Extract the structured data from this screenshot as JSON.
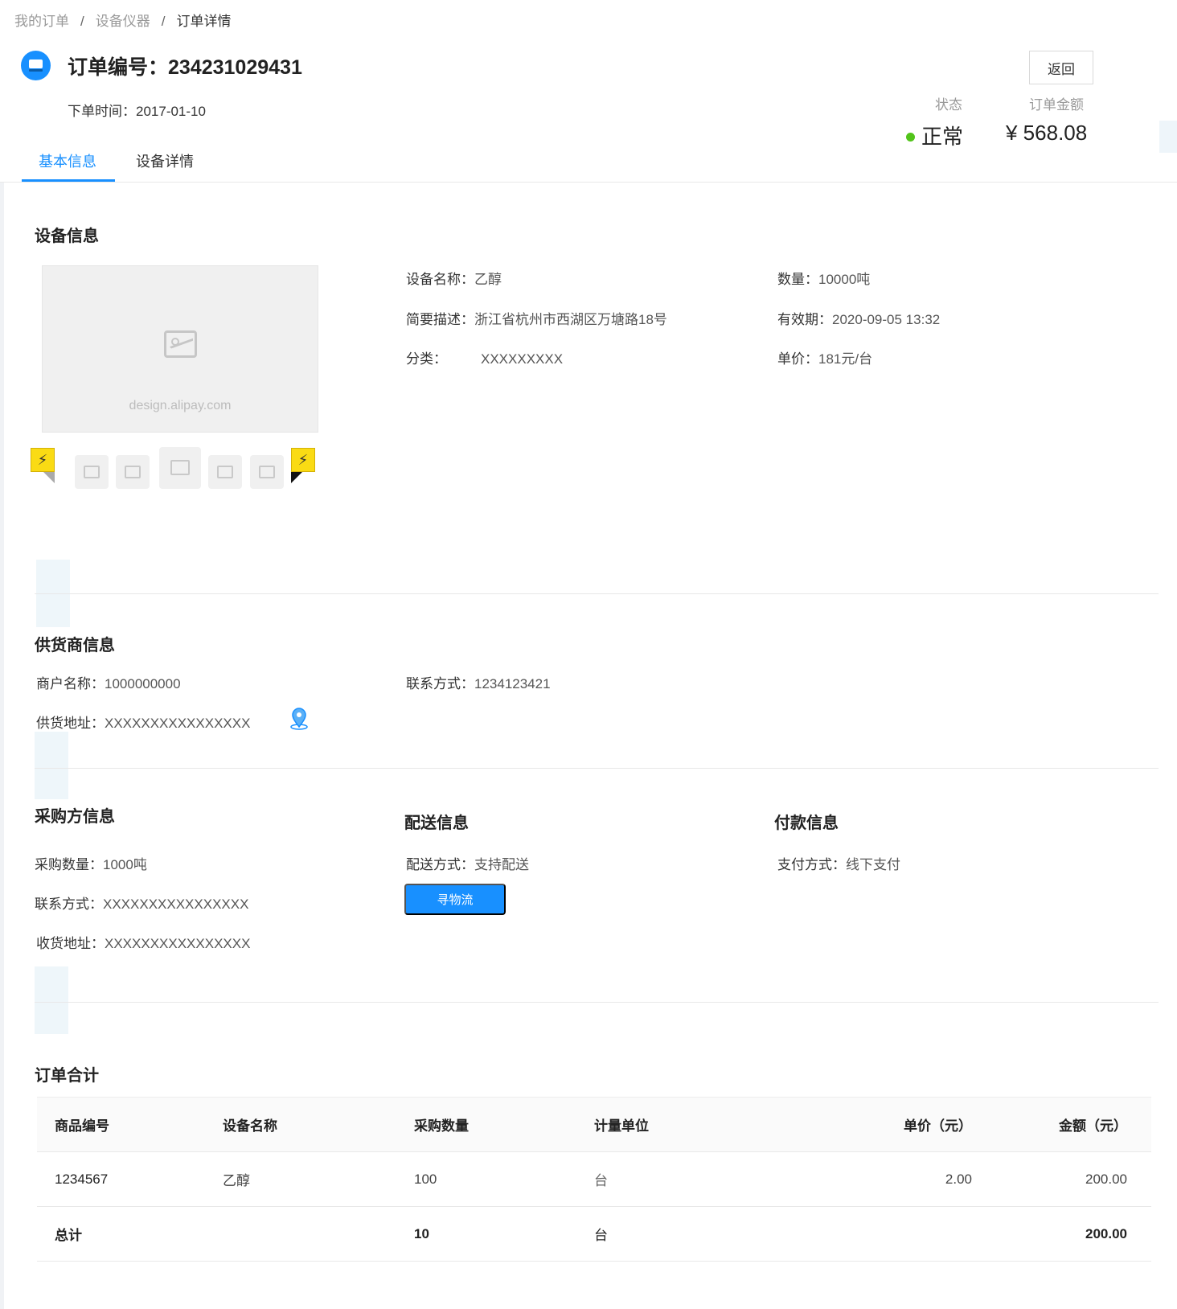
{
  "breadcrumb": [
    "我的订单",
    "设备仪器",
    "订单详情"
  ],
  "header": {
    "title": "订单编号：234231029431",
    "order_time_label": "下单时间：",
    "order_time": "2017-01-10",
    "back_label": "返回",
    "status_label": "状态",
    "status_value": "正常",
    "status_color": "#52c41a",
    "amount_label": "订单金额",
    "amount_value": "¥ 568.08"
  },
  "tabs": [
    {
      "label": "基本信息",
      "active": true
    },
    {
      "label": "设备详情",
      "active": false
    }
  ],
  "device": {
    "section_title": "设备信息",
    "image_caption": "design.alipay.com",
    "fields": [
      {
        "label": "设备名称：",
        "value": "乙醇"
      },
      {
        "label": "数量：",
        "value": "10000吨"
      },
      {
        "label": "简要描述：",
        "value": "浙江省杭州市西湖区万塘路18号"
      },
      {
        "label": "有效期：",
        "value": "2020-09-05 13:32"
      },
      {
        "label": "分类：",
        "value": "XXXXXXXXX"
      },
      {
        "label": "单价：",
        "value": "181元/台"
      }
    ]
  },
  "supplier": {
    "section_title": "供货商信息",
    "merchant_label": "商户名称：",
    "merchant_value": "1000000000",
    "contact_label": "联系方式：",
    "contact_value": "1234123421",
    "address_label": "供货地址：",
    "address_value": "XXXXXXXXXXXXXXXX"
  },
  "buyer": {
    "section_title": "采购方信息",
    "qty_label": "采购数量：",
    "qty_value": "1000吨",
    "contact_label": "联系方式：",
    "contact_value": "XXXXXXXXXXXXXXXX",
    "address_label": "收货地址：",
    "address_value": "XXXXXXXXXXXXXXXX"
  },
  "delivery": {
    "section_title": "配送信息",
    "method_label": "配送方式：",
    "method_value": "支持配送",
    "button_label": "寻物流"
  },
  "payment": {
    "section_title": "付款信息",
    "method_label": "支付方式：",
    "method_value": "线下支付"
  },
  "summary": {
    "section_title": "订单合计",
    "columns": [
      "商品编号",
      "设备名称",
      "采购数量",
      "计量单位",
      "单价（元）",
      "金额（元）"
    ],
    "rows": [
      [
        "1234567",
        "乙醇",
        "100",
        "台",
        "2.00",
        "200.00"
      ]
    ],
    "total": [
      "总计",
      "",
      "10",
      "台",
      "",
      "200.00"
    ]
  },
  "colors": {
    "primary": "#1890ff",
    "status_ok": "#52c41a"
  }
}
